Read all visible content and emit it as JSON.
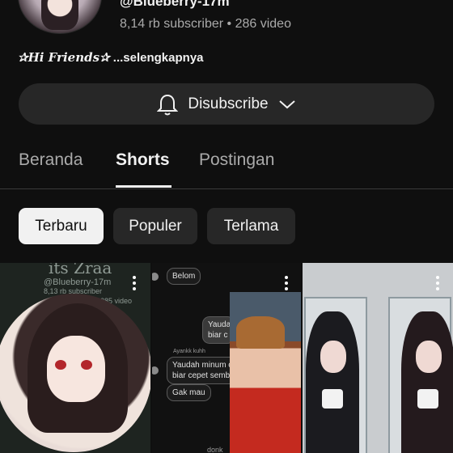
{
  "channel": {
    "handle": "@Blueberry-17m",
    "subscribers": "8,14 rb subscriber",
    "separator": "•",
    "videos": "286 video",
    "description_fancy": "✰Hi Friends✰",
    "description_more": "...selengkapnya"
  },
  "subscribe_button": {
    "label": "Disubscribe",
    "icon": "bell-icon",
    "dropdown_icon": "chevron-down-icon"
  },
  "tabs": [
    {
      "label": "Beranda",
      "active": false
    },
    {
      "label": "Shorts",
      "active": true
    },
    {
      "label": "Postingan",
      "active": false
    }
  ],
  "filters": [
    {
      "label": "Terbaru",
      "selected": true
    },
    {
      "label": "Populer",
      "selected": false
    },
    {
      "label": "Terlama",
      "selected": false
    }
  ],
  "shorts": [
    {
      "thumb_text": [
        "its Zraa",
        "@Blueberry-17m",
        "8,13 rb subscriber",
        "285 video"
      ]
    },
    {
      "chat": [
        "Belom",
        "Yauda biar c",
        "Yaudah minum c biar cepet semb",
        "Gak mau",
        "Ayankk kuhh",
        "donk"
      ]
    },
    {}
  ],
  "colors": {
    "background": "#0f0f0f",
    "surface": "#272727",
    "text_primary": "#f1f1f1",
    "text_secondary": "#aaaaaa",
    "chip_selected_bg": "#f1f1f1",
    "chip_selected_text": "#0f0f0f"
  }
}
